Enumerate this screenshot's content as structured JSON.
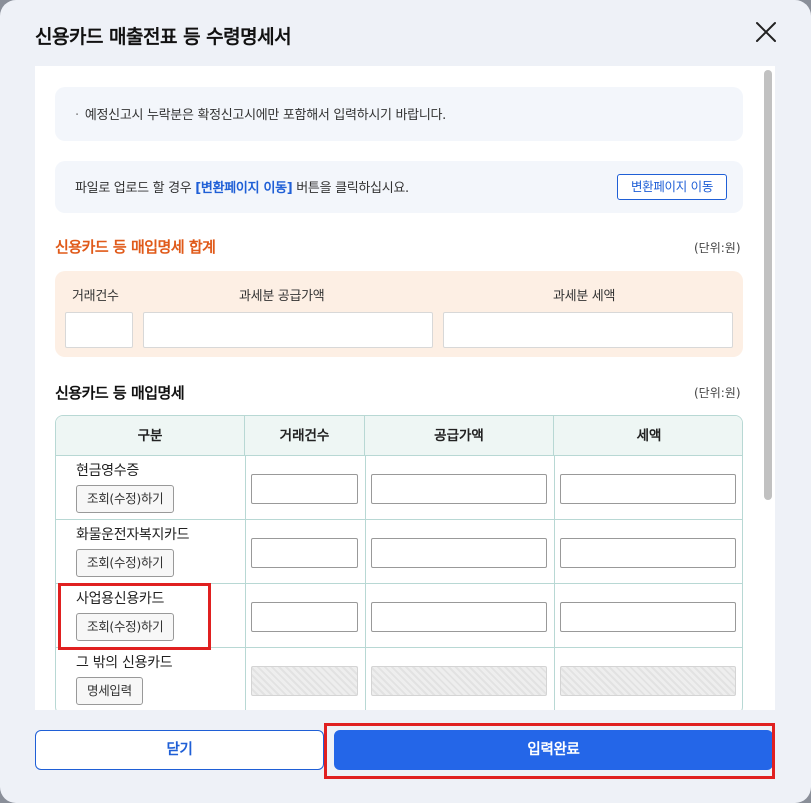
{
  "modal": {
    "title": "신용카드 매출전표 등 수령명세서"
  },
  "notice": {
    "bullet": "·",
    "text": "예정신고시 누락분은 확정신고시에만 포함해서 입력하시기 바랍니다."
  },
  "upload": {
    "text_before": "파일로 업로드 할 경우 ",
    "text_highlight": "[변환페이지 이동]",
    "text_after": " 버튼을 클릭하십시요.",
    "button_label": "변환페이지 이동"
  },
  "summary": {
    "title": "신용카드 등 매입명세 합계",
    "unit": "(단위:원)",
    "labels": {
      "count": "거래건수",
      "supply": "과세분 공급가액",
      "tax": "과세분 세액"
    },
    "values": {
      "count": "",
      "supply": "",
      "tax": ""
    }
  },
  "detail": {
    "title": "신용카드 등 매입명세",
    "unit": "(단위:원)",
    "headers": [
      "구분",
      "거래건수",
      "공급가액",
      "세액"
    ],
    "rows": [
      {
        "label": "현금영수증",
        "button": "조회(수정)하기",
        "editable": true
      },
      {
        "label": "화물운전자복지카드",
        "button": "조회(수정)하기",
        "editable": true
      },
      {
        "label": "사업용신용카드",
        "button": "조회(수정)하기",
        "editable": true,
        "highlighted": true
      },
      {
        "label": "그 밖의 신용카드",
        "button": "명세입력",
        "editable": false
      }
    ]
  },
  "footer": {
    "close_label": "닫기",
    "submit_label": "입력완료",
    "submit_highlighted": true
  },
  "colors": {
    "accent": "#2466e8",
    "summary_title": "#e05a1a",
    "highlight_border": "#e02020"
  }
}
